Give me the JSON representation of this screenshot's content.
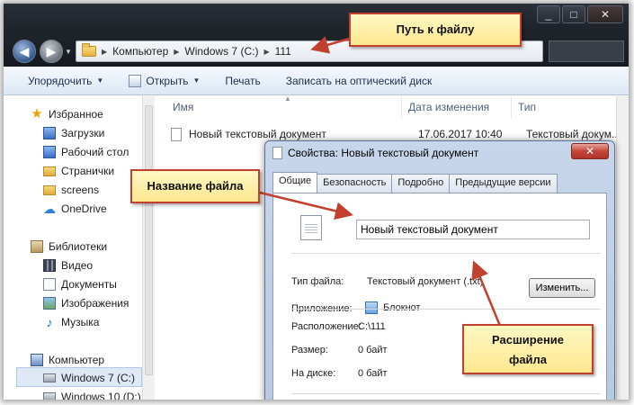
{
  "window": {
    "minimize": "_",
    "maximize": "□",
    "close": "✕"
  },
  "nav": {
    "back": "◀",
    "forward": "▶",
    "address": {
      "segments": [
        "Компьютер",
        "Windows 7 (C:)",
        "111"
      ]
    }
  },
  "toolbar": {
    "organize": "Упорядочить",
    "open": "Открыть",
    "print": "Печать",
    "burn": "Записать на оптический диск"
  },
  "sidebar": {
    "favorites": {
      "title": "Избранное",
      "items": [
        "Загрузки",
        "Рабочий стол",
        "Странички",
        "screens",
        "OneDrive"
      ]
    },
    "libraries": {
      "title": "Библиотеки",
      "items": [
        "Видео",
        "Документы",
        "Изображения",
        "Музыка"
      ]
    },
    "computer": {
      "title": "Компьютер",
      "items": [
        "Windows 7 (C:)",
        "Windows 10 (D:)"
      ]
    }
  },
  "list": {
    "columns": [
      "Имя",
      "Дата изменения",
      "Тип"
    ],
    "rows": [
      {
        "name": "Новый текстовый документ",
        "date": "17.06.2017 10:40",
        "type": "Текстовый докум..."
      }
    ]
  },
  "dialog": {
    "title": "Свойства: Новый текстовый документ",
    "close": "✕",
    "tabs": [
      "Общие",
      "Безопасность",
      "Подробно",
      "Предыдущие версии"
    ],
    "file_name": "Новый текстовый документ",
    "props": {
      "type_label": "Тип файла:",
      "type_value": "Текстовый документ (.txt)",
      "app_label": "Приложение:",
      "app_value": "Блокнот",
      "change_button": "Изменить...",
      "location_label": "Расположение:",
      "location_value": "C:\\111",
      "size_label": "Размер:",
      "size_value": "0 байт",
      "disk_label": "На диске:",
      "disk_value": "0 байт"
    }
  },
  "callouts": {
    "path": "Путь к файлу",
    "name": "Название файла",
    "ext_line1": "Расширение",
    "ext_line2": "файла"
  },
  "colors": {
    "callout_border": "#c2412e",
    "callout_fill": "#fde78f",
    "arrow": "#c2412e"
  }
}
